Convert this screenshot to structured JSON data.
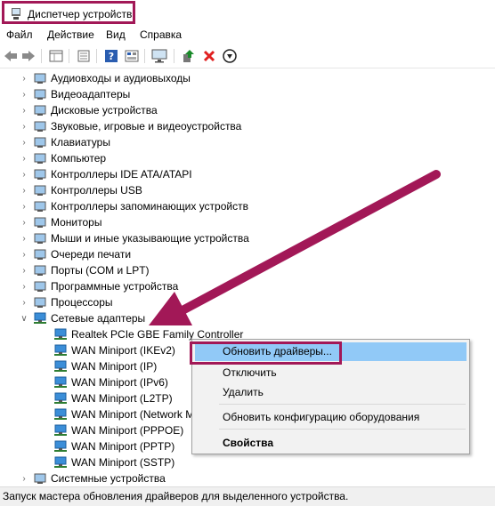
{
  "window": {
    "title": "Диспетчер устройств"
  },
  "menu": {
    "file": "Файл",
    "action": "Действие",
    "view": "Вид",
    "help": "Справка"
  },
  "toolbar": {
    "icons": [
      "back-icon",
      "forward-icon",
      "properties-grid-icon",
      "list-view-icon",
      "help-icon",
      "action-icon",
      "monitor-scan-icon",
      "update-driver-icon",
      "remove-icon",
      "download-icon"
    ],
    "colors": {
      "remove": "#e02020",
      "help": "#2a5db0",
      "update": "#1a8a2a"
    }
  },
  "tree": {
    "categories": [
      "Аудиовходы и аудиовыходы",
      "Видеоадаптеры",
      "Дисковые устройства",
      "Звуковые, игровые и видеоустройства",
      "Клавиатуры",
      "Компьютер",
      "Контроллеры IDE ATA/ATAPI",
      "Контроллеры USB",
      "Контроллеры запоминающих устройств",
      "Мониторы",
      "Мыши и иные указывающие устройства",
      "Очереди печати",
      "Порты (COM и LPT)",
      "Программные устройства",
      "Процессоры",
      "Сетевые адаптеры"
    ],
    "network_children": [
      "Realtek PCIe GBE Family Controller",
      "WAN Miniport (IKEv2)",
      "WAN Miniport (IP)",
      "WAN Miniport (IPv6)",
      "WAN Miniport (L2TP)",
      "WAN Miniport (Network M",
      "WAN Miniport (PPPOE)",
      "WAN Miniport (PPTP)",
      "WAN Miniport (SSTP)"
    ],
    "last_category": "Системные устройства"
  },
  "context_menu": {
    "update": "Обновить драйверы...",
    "disable": "Отключить",
    "delete": "Удалить",
    "scan": "Обновить конфигурацию оборудования",
    "properties": "Свойства"
  },
  "status": {
    "text": "Запуск мастера обновления драйверов для выделенного устройства."
  },
  "accent": "#a21857",
  "highlight": "#91c9f7"
}
